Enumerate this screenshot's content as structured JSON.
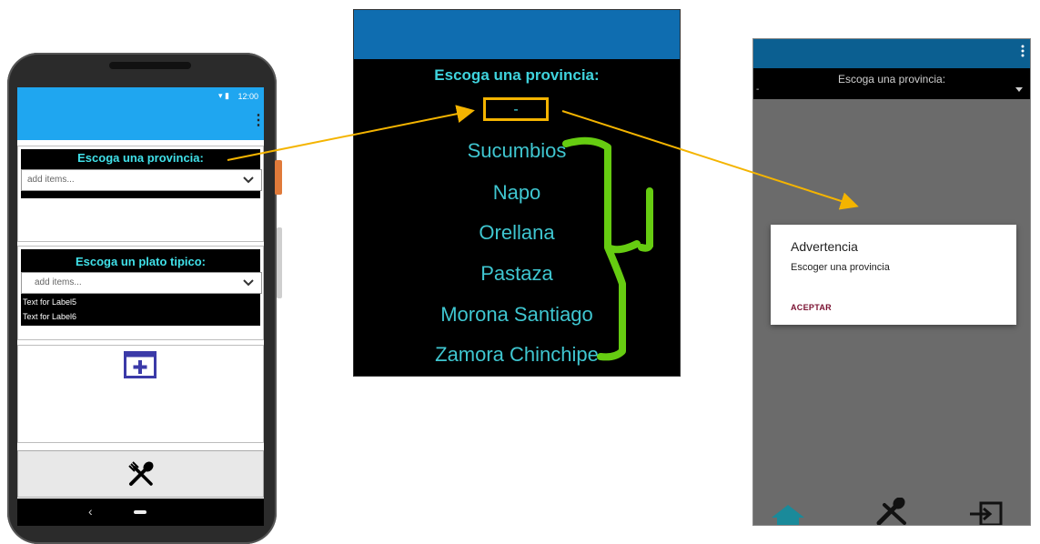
{
  "phone1": {
    "status_time": "12:00",
    "status_icons": "▾ ▮",
    "menu_icon": "⋮",
    "province_label": "Escoga una provincia:",
    "province_dropdown_placeholder": "add items...",
    "dish_label": "Escoga un plato tipico:",
    "dish_dropdown_placeholder": "add items...",
    "label5": "Text for Label5",
    "label6": "Text for Label6",
    "nav_back": "‹"
  },
  "middle_panel": {
    "title": "Escoga una provincia:",
    "selected_value": "-",
    "provinces": [
      "Sucumbios",
      "Napo",
      "Orellana",
      "Pastaza",
      "Morona Santiago",
      "Zamora Chinchipe"
    ]
  },
  "right_phone": {
    "spinner_label": "Escoga una provincia:",
    "spinner_value": "-",
    "dialog": {
      "title": "Advertencia",
      "message": "Escoger una provincia",
      "button": "ACEPTAR"
    }
  },
  "colors": {
    "app_bar_blue": "#1fa6f0",
    "cyan_text": "#40e0e8",
    "highlight_yellow": "#f4b400",
    "annotation_green": "#66cc11",
    "dialog_button": "#7a1030",
    "add_icon_purple": "#3b3aa8"
  },
  "icons": {
    "add_icon": "add-box-icon",
    "restaurant_icon": "fork-spoon-icon",
    "home_icon": "home-icon",
    "logout_icon": "exit-icon"
  }
}
